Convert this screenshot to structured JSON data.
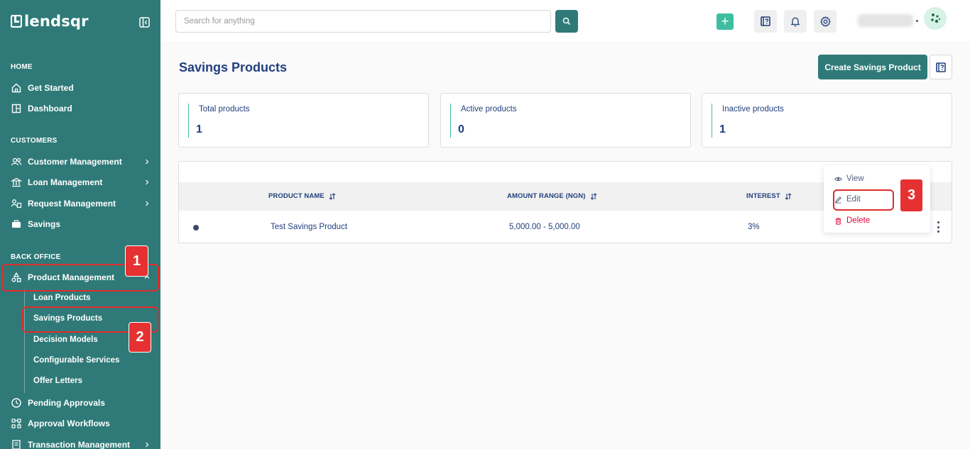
{
  "brand": {
    "name": "lendsqr"
  },
  "sidebar": {
    "sections": {
      "home": "HOME",
      "customers": "CUSTOMERS",
      "back_office": "BACK OFFICE"
    },
    "items": {
      "get_started": "Get Started",
      "dashboard": "Dashboard",
      "customer_management": "Customer Management",
      "loan_management": "Loan Management",
      "request_management": "Request Management",
      "savings": "Savings",
      "product_management": "Product Management",
      "pending_approvals": "Pending Approvals",
      "approval_workflows": "Approval Workflows",
      "transaction_management": "Transaction Management"
    },
    "product_management_sub": {
      "loan_products": "Loan Products",
      "savings_products": "Savings Products",
      "decision_models": "Decision Models",
      "configurable_services": "Configurable Services",
      "offer_letters": "Offer Letters"
    }
  },
  "topbar": {
    "search_placeholder": "Search for anything",
    "plus_label": "+"
  },
  "main": {
    "title": "Savings Products",
    "create_button": "Create Savings Product",
    "stats": [
      {
        "label": "Total products",
        "value": "1"
      },
      {
        "label": "Active products",
        "value": "0"
      },
      {
        "label": "Inactive products",
        "value": "1"
      }
    ],
    "table": {
      "columns": [
        "PRODUCT NAME",
        "AMOUNT RANGE (NGN)",
        "INTEREST"
      ],
      "rows": [
        {
          "name": "Test Savings Product",
          "amount_range": "5,000.00 - 5,000.00",
          "interest": "3%"
        }
      ]
    },
    "row_menu": {
      "view": "View",
      "edit": "Edit",
      "delete": "Delete"
    }
  },
  "annotations": [
    "1",
    "2",
    "3"
  ],
  "colors": {
    "sidebar": "#2f7a78",
    "accent": "#3dbea0",
    "text": "#213f7d",
    "danger": "#e4033b",
    "annotation": "#e53131"
  }
}
